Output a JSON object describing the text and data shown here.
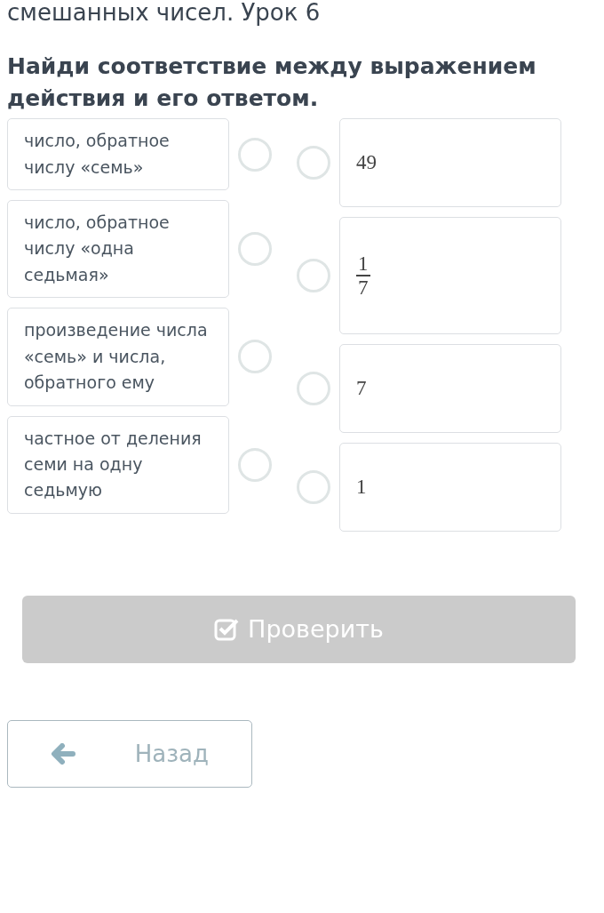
{
  "lesson_title": "смешанных чисел. Урок 6",
  "question": "Найди соответствие между выражением действия и его ответом.",
  "left_items": [
    {
      "text": "число, обратное числу «семь»",
      "selected": false
    },
    {
      "text": "число, обратное числу «одна седьмая»",
      "selected": false
    },
    {
      "text": "произведение числа «семь» и числа, обратного ему",
      "selected": false
    },
    {
      "text": "частное от деления семи на одну седьмую",
      "selected": false
    }
  ],
  "right_items": [
    {
      "kind": "number",
      "text": "49",
      "selected": false
    },
    {
      "kind": "fraction",
      "numerator": "1",
      "denominator": "7",
      "selected": false
    },
    {
      "kind": "number",
      "text": "7",
      "selected": false
    },
    {
      "kind": "number",
      "text": "1",
      "selected": false
    }
  ],
  "check_button": {
    "label": "Проверить",
    "disabled": true
  },
  "back_button": {
    "label": "Назад"
  }
}
